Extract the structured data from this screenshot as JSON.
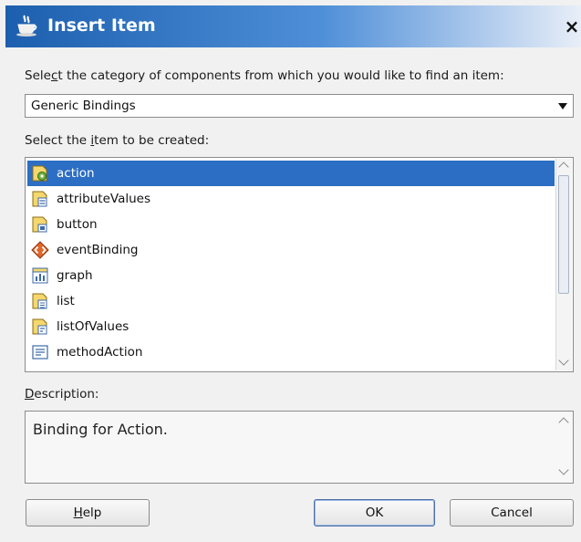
{
  "dialog": {
    "title": "Insert Item",
    "close_label": "×"
  },
  "category": {
    "label_pre": "Sele",
    "label_mnemonic": "c",
    "label_post": "t the category of components from which you would like to find an item:",
    "selected_value": "Generic Bindings"
  },
  "items_section": {
    "label_pre": "Select the ",
    "label_mnemonic": "i",
    "label_post": "tem to be created:",
    "items": [
      {
        "label": "action",
        "icon": "action-binding-icon",
        "selected": true
      },
      {
        "label": "attributeValues",
        "icon": "attribute-values-icon",
        "selected": false
      },
      {
        "label": "button",
        "icon": "button-binding-icon",
        "selected": false
      },
      {
        "label": "eventBinding",
        "icon": "event-binding-icon",
        "selected": false
      },
      {
        "label": "graph",
        "icon": "graph-binding-icon",
        "selected": false
      },
      {
        "label": "list",
        "icon": "list-binding-icon",
        "selected": false
      },
      {
        "label": "listOfValues",
        "icon": "list-of-values-icon",
        "selected": false
      },
      {
        "label": "methodAction",
        "icon": "method-action-icon",
        "selected": false
      }
    ]
  },
  "description": {
    "label_mnemonic": "D",
    "label_post": "escription:",
    "text": "Binding for Action."
  },
  "buttons": {
    "help_mnemonic": "H",
    "help_post": "elp",
    "ok": "OK",
    "cancel": "Cancel"
  },
  "colors": {
    "selection": "#2b6ec4",
    "titlebar_start": "#1c5fae",
    "titlebar_end": "#e8eef8"
  }
}
